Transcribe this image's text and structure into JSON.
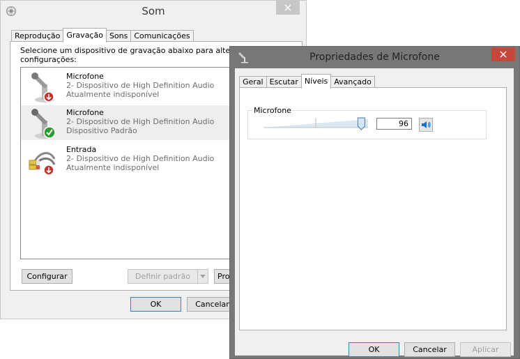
{
  "som": {
    "title": "Som",
    "tabs": [
      "Reprodução",
      "Gravação",
      "Sons",
      "Comunicações"
    ],
    "active_tab": 1,
    "instruction_line1": "Selecione um dispositivo de gravação abaixo para alterar s",
    "instruction_line2": "configurações:",
    "devices": [
      {
        "name": "Microfone",
        "line2": "2- Dispositivo de High Definition Audio",
        "line3": "Atualmente indisponível",
        "icon": "microphone-icon",
        "status": "unavailable"
      },
      {
        "name": "Microfone",
        "line2": "2- Dispositivo de High Definition Audio",
        "line3": "Dispositivo Padrão",
        "icon": "microphone-icon",
        "status": "default",
        "selected": true
      },
      {
        "name": "Entrada",
        "line2": "2- Dispositivo de High Definition Audio",
        "line3": "Atualmente indisponível",
        "icon": "line-in-jack-icon",
        "status": "unavailable"
      }
    ],
    "buttons": {
      "configure": "Configurar",
      "set_default": "Definir padrão",
      "properties": "Pro",
      "ok": "OK",
      "cancel": "Cancelar"
    }
  },
  "props": {
    "title": "Propriedades de Microfone",
    "tabs": [
      "Geral",
      "Escutar",
      "Níveis",
      "Avançado"
    ],
    "active_tab": 2,
    "group_label": "Microfone",
    "level_value": "96",
    "level_fraction": 0.96,
    "buttons": {
      "ok": "OK",
      "cancel": "Cancelar",
      "apply": "Aplicar"
    }
  },
  "colors": {
    "unavailable_badge": "#c8322d",
    "default_badge": "#2e9b2e",
    "close_active": "#c7463c",
    "speaker_blue": "#1a6fc9"
  }
}
